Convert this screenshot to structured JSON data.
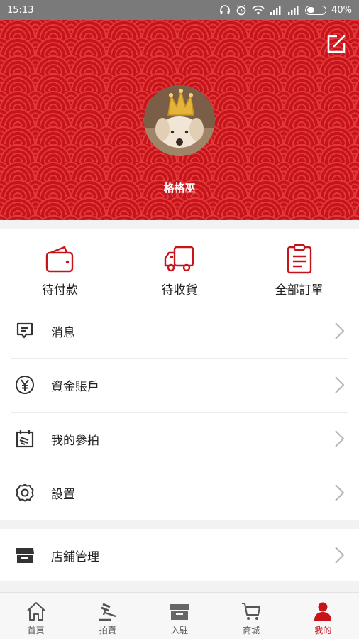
{
  "status_bar": {
    "time": "15:13",
    "battery": "40%",
    "battery_level": 0.4
  },
  "profile": {
    "username": "格格巫"
  },
  "orders": [
    {
      "label": "待付款",
      "icon": "wallet-icon"
    },
    {
      "label": "待收貨",
      "icon": "truck-icon"
    },
    {
      "label": "全部訂單",
      "icon": "clipboard-icon"
    }
  ],
  "menu": [
    {
      "label": "消息",
      "icon": "message-icon"
    },
    {
      "label": "資金賬戶",
      "icon": "yen-icon"
    },
    {
      "label": "我的參拍",
      "icon": "auction-board-icon"
    },
    {
      "label": "設置",
      "icon": "gear-icon"
    }
  ],
  "menu2": [
    {
      "label": "店鋪管理",
      "icon": "store-icon"
    }
  ],
  "tabs": [
    {
      "label": "首頁",
      "icon": "home-icon",
      "active": false
    },
    {
      "label": "拍賣",
      "icon": "gavel-icon",
      "active": false
    },
    {
      "label": "入駐",
      "icon": "shop-icon",
      "active": false
    },
    {
      "label": "商城",
      "icon": "cart-icon",
      "active": false
    },
    {
      "label": "我的",
      "icon": "person-icon",
      "active": true
    }
  ],
  "colors": {
    "accent": "#c7141b",
    "status_bar": "#7a7a7a",
    "icon_dark": "#333333"
  }
}
